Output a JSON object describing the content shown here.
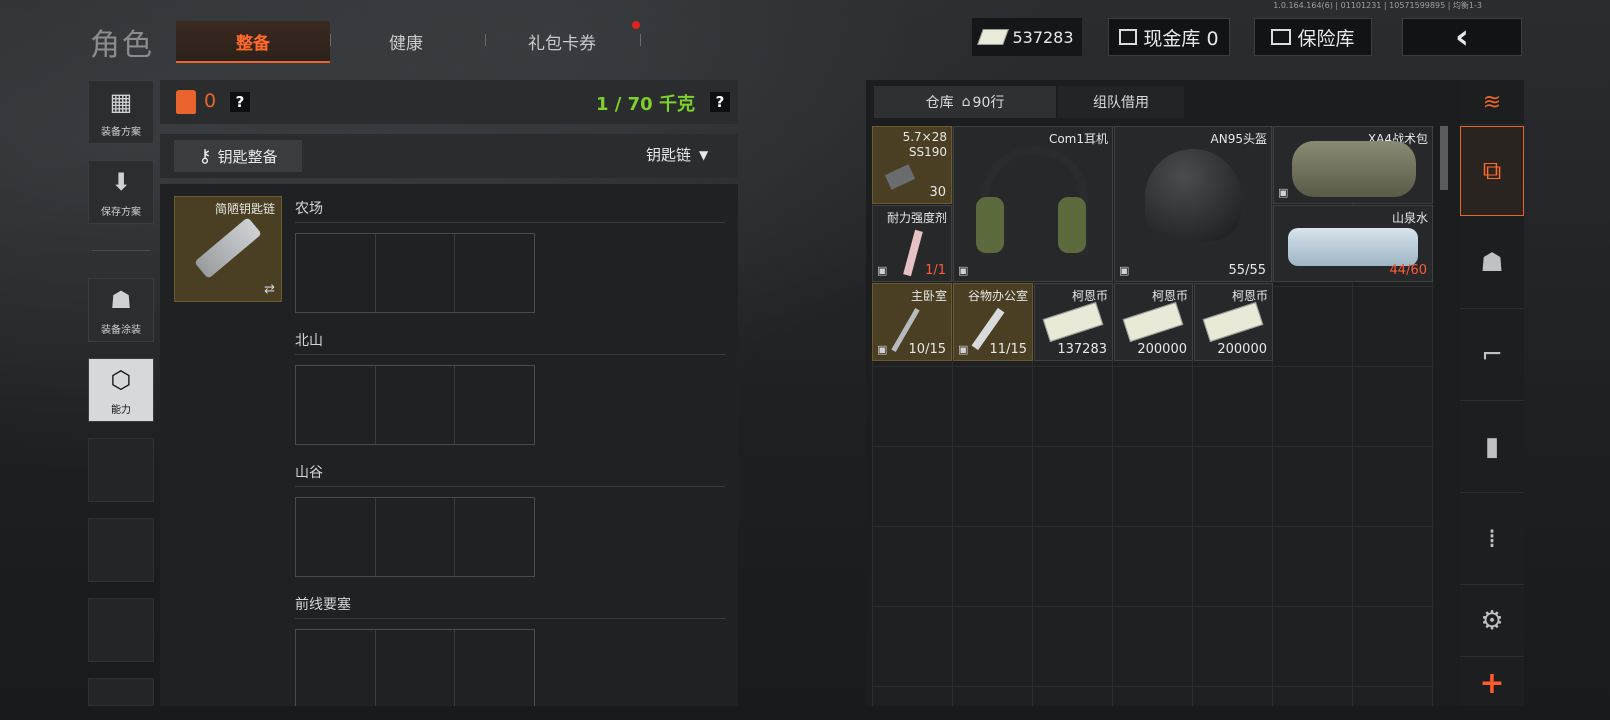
{
  "version": "1.0.164.164(6) | 01101231 | 10571599895 | 均衡1-3",
  "title": "角色",
  "tabs": [
    {
      "label": "整备",
      "active": true
    },
    {
      "label": "健康",
      "active": false
    },
    {
      "label": "礼包卡券",
      "active": false,
      "badge": true
    }
  ],
  "topbar": {
    "money": "537283",
    "cash_vault": "现金库 0",
    "safe": "保险库",
    "back_icon": "chevron-left-icon"
  },
  "left_menu": [
    {
      "label": "装备方案",
      "icon": "vest-icon"
    },
    {
      "label": "保存方案",
      "icon": "download-icon"
    },
    {
      "label": "装备涂装",
      "icon": "helmet-icon"
    },
    {
      "label": "能力",
      "icon": "ability-icon"
    }
  ],
  "loadout": {
    "armor_count": "0",
    "weight": "1 / 70 千克",
    "help": "?",
    "key_btn": "钥匙整备",
    "dropdown": "钥匙链",
    "keychain_name": "简陋钥匙链",
    "swap_icon": "⇄",
    "sections": [
      "农场",
      "北山",
      "山谷",
      "前线要塞"
    ]
  },
  "storage": {
    "tab_main": "仓库",
    "rows": "90行",
    "tab_team": "组队借用",
    "items": [
      {
        "name": "5.7×28\nSS190",
        "count": "30",
        "gold": true
      },
      {
        "name": "Com1耳机",
        "count": ""
      },
      {
        "name": "AN95头盔",
        "count": "55/55"
      },
      {
        "name": "XA4战术包",
        "count": ""
      },
      {
        "name": "耐力强度剂",
        "count": "1/1",
        "red": true
      },
      {
        "name": "山泉水",
        "count": "44/60",
        "red": true
      },
      {
        "name": "主卧室",
        "count": "10/15",
        "gold": true
      },
      {
        "name": "谷物办公室",
        "count": "11/15",
        "gold": true
      },
      {
        "name": "柯恩币",
        "count": "137283"
      },
      {
        "name": "柯恩币",
        "count": "200000"
      },
      {
        "name": "柯恩币",
        "count": "200000"
      }
    ]
  },
  "colors": {
    "accent": "#e8642c",
    "weight_green": "#7cd12c",
    "warn_red": "#ff5a3a"
  }
}
